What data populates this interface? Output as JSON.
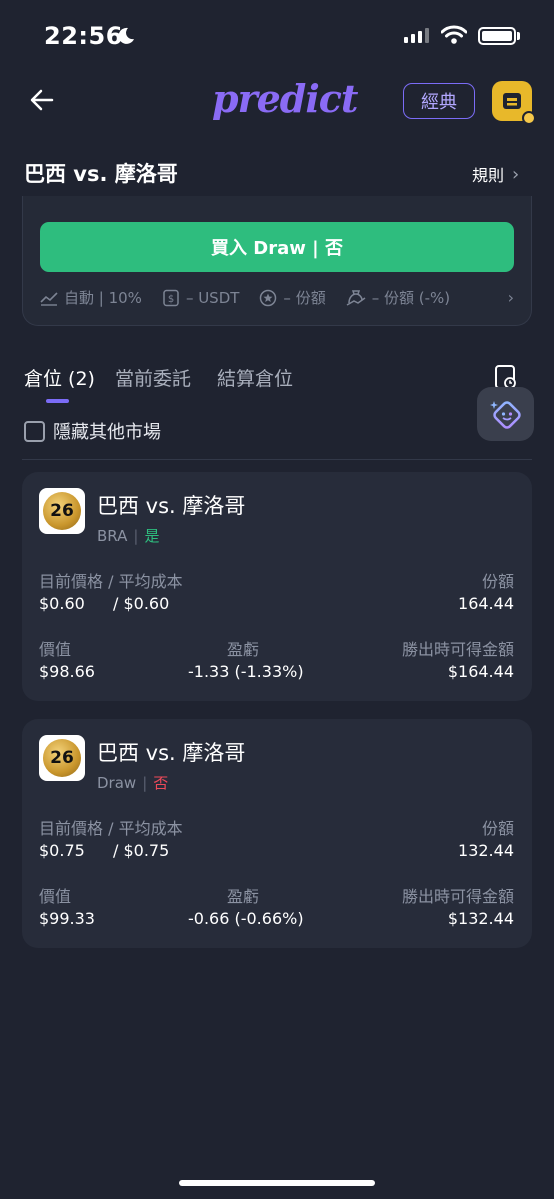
{
  "status_bar": {
    "time": "22:56"
  },
  "header": {
    "logo": "predict",
    "classic_label": "經典"
  },
  "match": {
    "title": "巴西 vs. 摩洛哥",
    "rules_label": "規則"
  },
  "order": {
    "buy_label": "買入 Draw | 否",
    "stats": [
      "自動 | 10%",
      "– USDT",
      "– 份額",
      "– 份額 (-%)"
    ]
  },
  "tabs": [
    {
      "label": "倉位 (2)",
      "active": true
    },
    {
      "label": "當前委託",
      "active": false
    },
    {
      "label": "結算倉位",
      "active": false
    }
  ],
  "filter": {
    "hide_other_label": "隱藏其他市場"
  },
  "positions": [
    {
      "badge": "26",
      "name": "巴西 vs. 摩洛哥",
      "outcome_code": "BRA",
      "side": "是",
      "side_color": "#2ebd7e",
      "price_label": "目前價格 / 平均成本",
      "current_price": "$0.60",
      "avg_cost": "/ $0.60",
      "shares_label": "份額",
      "shares": "164.44",
      "value_label": "價值",
      "value": "$98.66",
      "pnl_label": "盈虧",
      "pnl": "-1.33 (-1.33%)",
      "payout_label": "勝出時可得金額",
      "payout": "$164.44"
    },
    {
      "badge": "26",
      "name": "巴西 vs. 摩洛哥",
      "outcome_code": "Draw",
      "side": "否",
      "side_color": "#ef4a5a",
      "price_label": "目前價格 / 平均成本",
      "current_price": "$0.75",
      "avg_cost": "/ $0.75",
      "shares_label": "份額",
      "shares": "132.44",
      "value_label": "價值",
      "value": "$99.33",
      "pnl_label": "盈虧",
      "pnl": "-0.66 (-0.66%)",
      "payout_label": "勝出時可得金額",
      "payout": "$132.44"
    }
  ],
  "colors": {
    "accent": "#7b6cf6",
    "buy_green": "#2ebd7e",
    "loss_red": "#ef4a5a",
    "background": "#1f2330"
  }
}
